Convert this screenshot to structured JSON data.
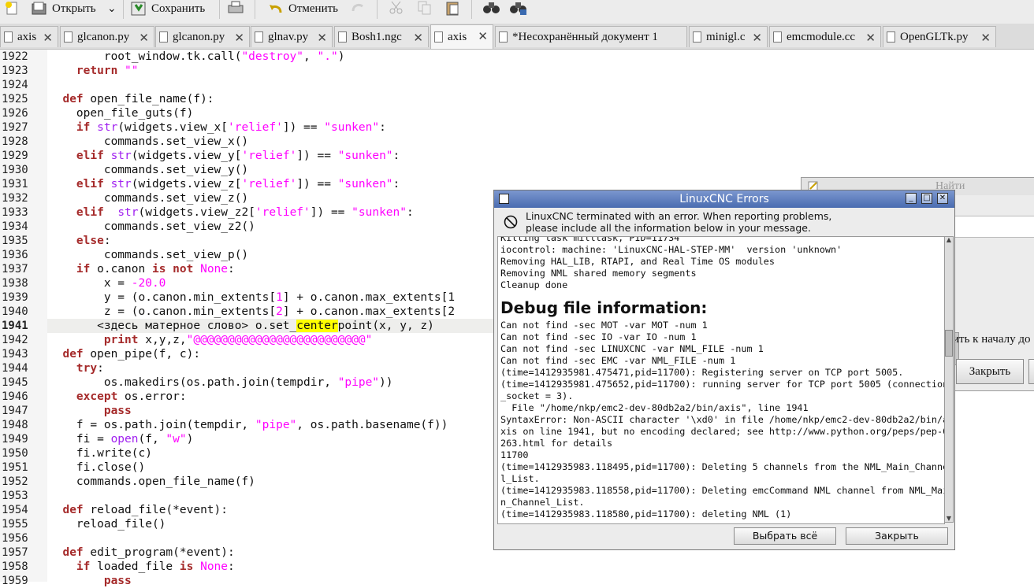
{
  "toolbar": {
    "open_label": "Открыть",
    "save_label": "Сохранить",
    "undo_label": "Отменить"
  },
  "tabs": [
    {
      "label": "axis"
    },
    {
      "label": "glcanon.py"
    },
    {
      "label": "glcanon.py"
    },
    {
      "label": "glnav.py"
    },
    {
      "label": "Bosh1.ngc"
    },
    {
      "label": "axis"
    },
    {
      "label": "*Несохранённый документ 1"
    },
    {
      "label": "minigl.c"
    },
    {
      "label": "emcmodule.cc"
    },
    {
      "label": "OpenGLTk.py"
    }
  ],
  "code": {
    "line_numbers": [
      "1922",
      "1923",
      "1924",
      "1925",
      "1926",
      "1927",
      "1928",
      "1929",
      "1930",
      "1931",
      "1932",
      "1933",
      "1934",
      "1935",
      "1936",
      "1937",
      "1938",
      "1939",
      "1940",
      "1941",
      "1942",
      "1943",
      "1944",
      "1945",
      "1946",
      "1947",
      "1948",
      "1949",
      "1950",
      "1951",
      "1952",
      "1953",
      "1954",
      "1955",
      "1956",
      "1957",
      "1958",
      "1959"
    ],
    "current_line": "1941"
  },
  "find_dialog": {
    "title": "Найти",
    "wrap_text": "ить к началу до",
    "close_label": "Закрыть"
  },
  "error_dialog": {
    "title": "LinuxCNC Errors",
    "message_line1": "LinuxCNC terminated with an error.  When reporting problems,",
    "message_line2": "please include all the information below in your message.",
    "log_lines_before": [
      "Killing task milltask, PID=11734",
      "iocontrol: machine: 'LinuxCNC-HAL-STEP-MM'  version 'unknown'",
      "Removing HAL_LIB, RTAPI, and Real Time OS modules",
      "Removing NML shared memory segments",
      "Cleanup done"
    ],
    "debug_heading": "Debug file information:",
    "log_lines_after": [
      "Can not find -sec MOT -var MOT -num 1",
      "Can not find -sec IO -var IO -num 1",
      "Can not find -sec LINUXCNC -var NML_FILE -num 1",
      "Can not find -sec EMC -var NML_FILE -num 1",
      "(time=1412935981.475471,pid=11700): Registering server on TCP port 5005.",
      "(time=1412935981.475652,pid=11700): running server for TCP port 5005 (connection",
      "_socket = 3).",
      "  File \"/home/nkp/emc2-dev-80db2a2/bin/axis\", line 1941",
      "SyntaxError: Non-ASCII character '\\xd0' in file /home/nkp/emc2-dev-80db2a2/bin/a",
      "xis on line 1941, but no encoding declared; see http://www.python.org/peps/pep-0",
      "263.html for details",
      "11700",
      "(time=1412935983.118495,pid=11700): Deleting 5 channels from the NML_Main_Channe",
      "l_List.",
      "(time=1412935983.118558,pid=11700): Deleting emcCommand NML channel from NML_Mai",
      "n_Channel_List.",
      "(time=1412935983.118580,pid=11700): deleting NML (1)"
    ],
    "select_all_label": "Выбрать всё",
    "close_label": "Закрыть"
  }
}
